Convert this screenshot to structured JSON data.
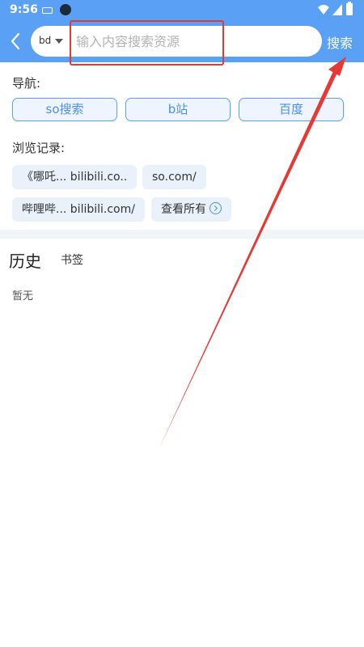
{
  "status_bar": {
    "time": "9:56"
  },
  "header": {
    "engine_label": "bd",
    "search_placeholder": "输入内容搜索资源",
    "search_label": "搜索"
  },
  "navigation": {
    "label": "导航:",
    "items": [
      "so搜索",
      "b站",
      "百度"
    ]
  },
  "browse_history": {
    "label": "浏览记录:",
    "items": [
      "《哪吒... bilibili.co..",
      "so.com/",
      "哔哩哔... bilibili.com/"
    ],
    "view_all_label": "查看所有"
  },
  "tabs": {
    "history_label": "历史",
    "bookmarks_label": "书签"
  },
  "empty_state": "暂无",
  "colors": {
    "header_blue": "#5aa0f5",
    "accent_blue": "#4a90e8",
    "annotation_red": "#e53935"
  },
  "icons": {
    "back": "chevron-left-icon",
    "engine_dropdown": "caret-down-icon",
    "view_all": "chevron-right-circle-icon"
  }
}
